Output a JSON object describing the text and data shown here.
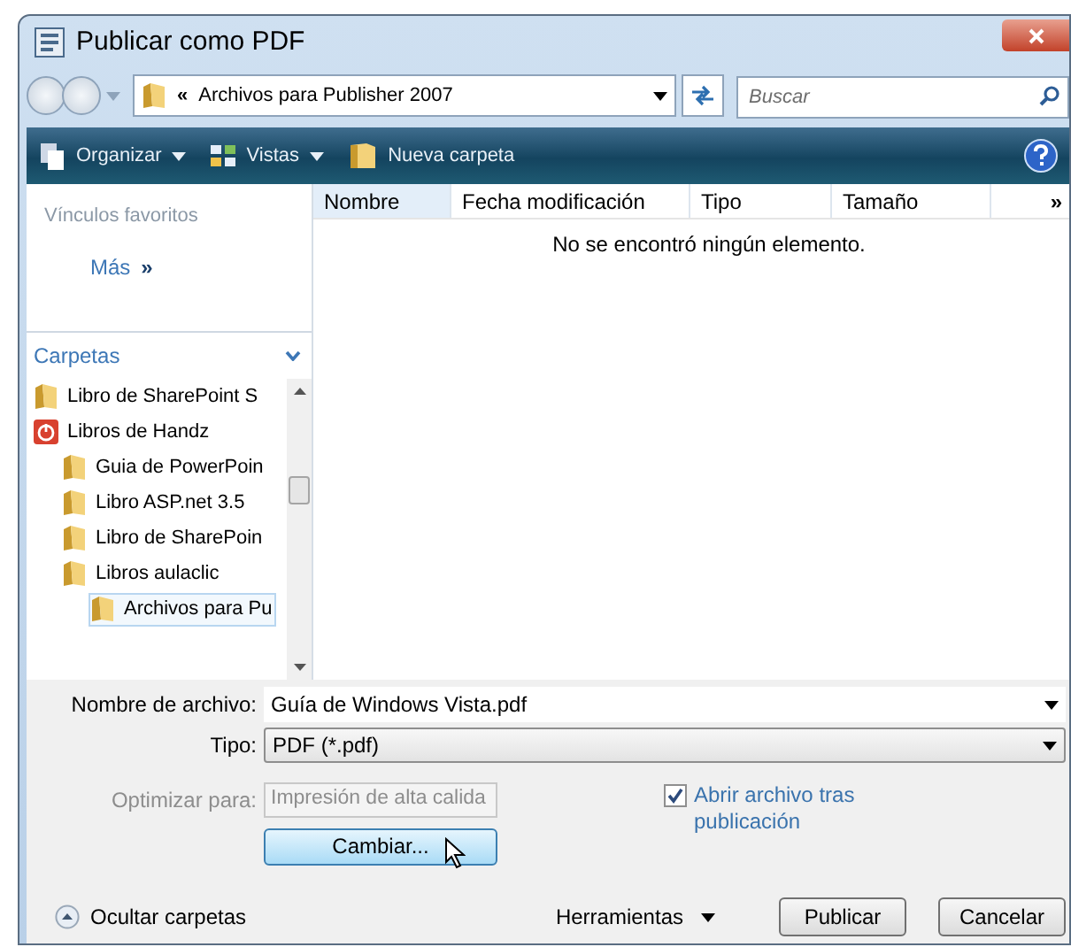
{
  "window": {
    "title": "Publicar como PDF"
  },
  "address": {
    "prefix": "«",
    "path": "Archivos para Publisher 2007"
  },
  "search": {
    "placeholder": "Buscar"
  },
  "toolbar": [
    {
      "label": "Organizar",
      "kind": "stack"
    },
    {
      "label": "Vistas",
      "kind": "views"
    },
    {
      "label": "Nueva carpeta",
      "kind": "folder"
    }
  ],
  "favorites": {
    "title": "Vínculos favoritos",
    "more": "Más",
    "more_icon": "»"
  },
  "folders": {
    "title": "Carpetas",
    "expanded": true,
    "items": [
      {
        "label": "Libro de SharePoint S",
        "kind": "folder",
        "selected": false
      },
      {
        "label": "Libros de Handz",
        "kind": "power",
        "selected": false,
        "children": [
          {
            "label": "Guia de PowerPoin",
            "kind": "folder",
            "selected": false
          },
          {
            "label": "Libro ASP.net 3.5",
            "kind": "folder",
            "selected": false
          },
          {
            "label": "Libro de SharePoin",
            "kind": "folder",
            "selected": false
          },
          {
            "label": "Libros aulaclic",
            "kind": "folder",
            "selected": false,
            "children": [
              {
                "label": "Archivos para Pu",
                "kind": "folder",
                "selected": true
              }
            ]
          }
        ]
      }
    ]
  },
  "table": {
    "columns": [
      {
        "label": "Nombre",
        "selected": true
      },
      {
        "label": "Fecha modificación",
        "selected": false
      },
      {
        "label": "Tipo",
        "selected": false
      },
      {
        "label": "Tamaño",
        "selected": false
      }
    ],
    "more": "»",
    "empty": "No se encontró ningún elemento."
  },
  "file_name": {
    "label": "Nombre de archivo:",
    "value": "Guía de Windows Vista.pdf"
  },
  "file_type": {
    "label": "Tipo:",
    "value": "PDF (*.pdf)"
  },
  "optimize": {
    "label": "Optimizar para:",
    "value": "Impresión de alta calida",
    "disabled": true
  },
  "change_button": "Cambiar...",
  "open_after": {
    "label": "Abrir archivo tras publicación",
    "checked": true
  },
  "hide_folders": "Ocultar carpetas",
  "tools": "Herramientas",
  "buttons": [
    "Publicar",
    "Cancelar"
  ]
}
